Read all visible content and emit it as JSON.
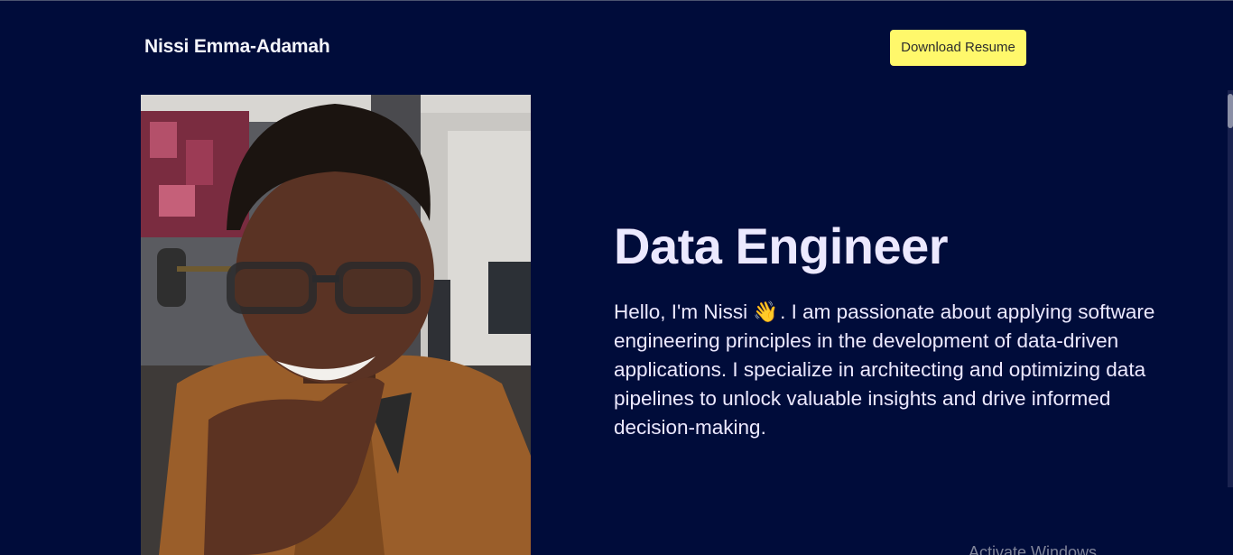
{
  "header": {
    "brand_name": "Nissi Emma-Adamah",
    "download_resume_label": "Download Resume"
  },
  "hero": {
    "headline": "Data Engineer",
    "bio_before_emoji": "Hello, I'm Nissi",
    "bio_emoji": "👋",
    "bio_after_emoji": ". I am passionate about applying software engineering principles in the development of data-driven applications. I specialize in architecting and optimizing data pipelines to unlock valuable insights and drive informed decision-making.",
    "photo_icon": "portrait-photo"
  },
  "system": {
    "watermark": "Activate Windows"
  },
  "colors": {
    "background": "#000c3a",
    "button": "#fff86b",
    "headline": "#ece9ff"
  }
}
